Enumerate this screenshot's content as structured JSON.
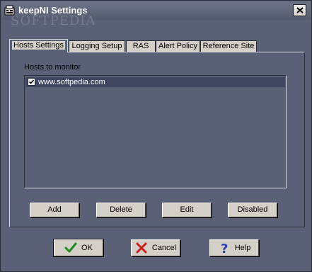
{
  "window": {
    "title": "keepNI Settings",
    "watermark": "SOFTPEDIA"
  },
  "tabs": [
    {
      "label": "Hosts Settings",
      "active": true
    },
    {
      "label": "Logging Setup",
      "active": false
    },
    {
      "label": "RAS",
      "active": false
    },
    {
      "label": "Alert Policy",
      "active": false
    },
    {
      "label": "Reference Site",
      "active": false
    }
  ],
  "hosts": {
    "group_label": "Hosts to monitor",
    "items": [
      {
        "label": "www.softpedia.com",
        "checked": true
      }
    ]
  },
  "host_buttons": {
    "add": "Add",
    "delete": "Delete",
    "edit": "Edit",
    "disabled": "Disabled"
  },
  "dialog_buttons": {
    "ok": "OK",
    "cancel": "Cancel",
    "help": "Help"
  },
  "colors": {
    "ok_check": "#1f8a1f",
    "cancel_x": "#d01c1c",
    "help_q": "#2a3fb0"
  },
  "icons": {
    "window": "app-icon",
    "close": "close-icon",
    "ok": "checkmark-icon",
    "cancel": "x-icon",
    "help": "question-mark-icon"
  }
}
